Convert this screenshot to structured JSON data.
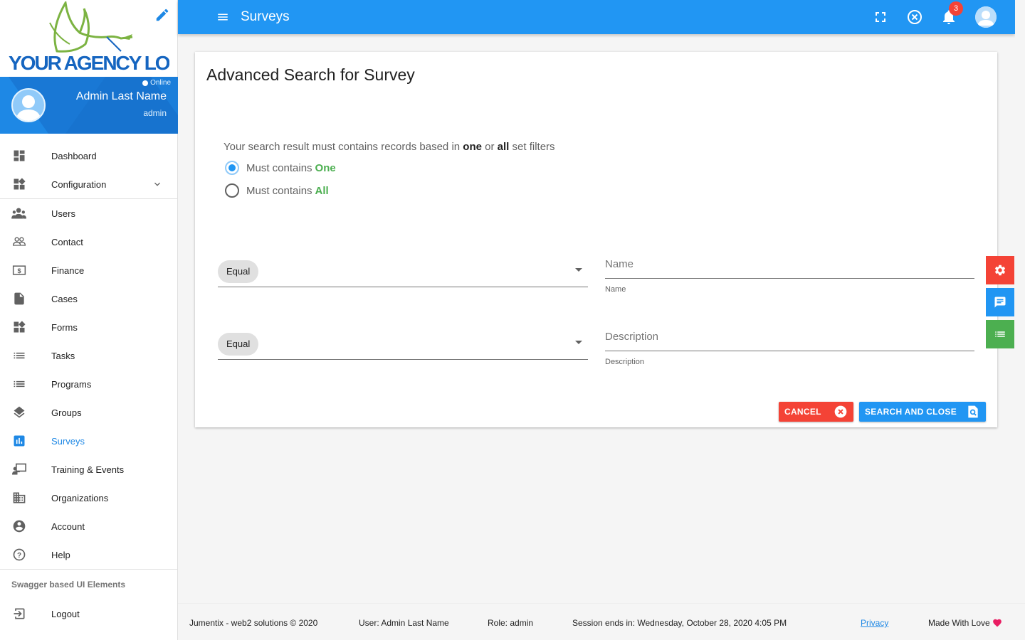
{
  "brand": {
    "logo_text": "YOUR AGENCY LOGO"
  },
  "profile": {
    "status": "Online",
    "name": "Admin Last Name",
    "role": "admin"
  },
  "nav": {
    "items": [
      {
        "label": "Dashboard",
        "icon": "dashboard-icon"
      },
      {
        "label": "Configuration",
        "icon": "widgets-icon"
      },
      {
        "label": "Users",
        "icon": "users-icon"
      },
      {
        "label": "Contact",
        "icon": "contact-icon"
      },
      {
        "label": "Finance",
        "icon": "finance-icon"
      },
      {
        "label": "Cases",
        "icon": "file-icon"
      },
      {
        "label": "Forms",
        "icon": "widgets-icon"
      },
      {
        "label": "Tasks",
        "icon": "list-icon"
      },
      {
        "label": "Programs",
        "icon": "list-icon"
      },
      {
        "label": "Groups",
        "icon": "layers-icon"
      },
      {
        "label": "Surveys",
        "icon": "chart-icon"
      },
      {
        "label": "Training & Events",
        "icon": "training-icon"
      },
      {
        "label": "Organizations",
        "icon": "building-icon"
      },
      {
        "label": "Account",
        "icon": "account-icon"
      },
      {
        "label": "Help",
        "icon": "help-icon"
      }
    ],
    "active": "Surveys",
    "section_label": "Swagger based UI Elements",
    "logout_label": "Logout"
  },
  "topbar": {
    "title": "Surveys",
    "notification_count": "3"
  },
  "search": {
    "title": "Advanced Search for Survey",
    "hint_prefix": "Your search result must contains records based in ",
    "hint_one": "one",
    "hint_or": " or ",
    "hint_all": "all",
    "hint_suffix": " set filters",
    "radio_one_label": "Must contains",
    "radio_one_em": "One",
    "radio_all_label": "Must contains",
    "radio_all_em": "All",
    "selected": "One",
    "filters": [
      {
        "operator": "Equal",
        "placeholder": "Name",
        "help": "Name"
      },
      {
        "operator": "Equal",
        "placeholder": "Description",
        "help": "Description"
      }
    ],
    "cancel_label": "CANCEL",
    "submit_label": "SEARCH AND CLOSE"
  },
  "colors": {
    "primary": "#2196f3",
    "danger": "#f44336",
    "success": "#4caf50"
  },
  "footer": {
    "copyright": "Jumentix - web2 solutions © 2020",
    "user": "User: Admin Last Name",
    "role": "Role: admin",
    "session": "Session ends in: Wednesday, October 28, 2020 4:05 PM",
    "privacy": "Privacy",
    "made_with": "Made With Love"
  }
}
